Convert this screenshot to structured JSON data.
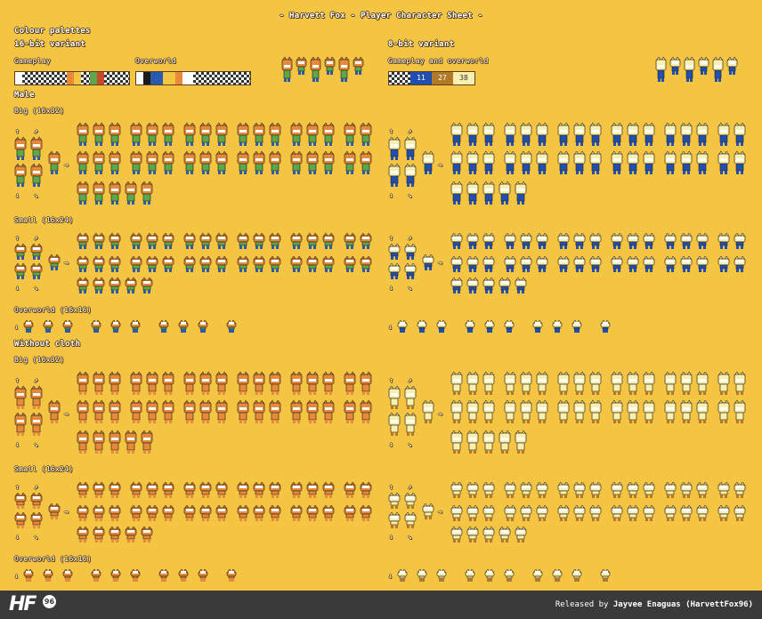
{
  "title": "- Harvett Fox - Player Character Sheet -",
  "palettes_heading": "Colour palettes",
  "variant16": "16-bit variant",
  "variant8": "8-bit variant",
  "gameplay_label": "Gameplay",
  "overworld_label": "Overworld",
  "gameplay_overworld_label": "Gameplay and overworld",
  "palette8_values": [
    "11",
    "27",
    "38"
  ],
  "palette8_colors": [
    "#1f4fb0",
    "#b07a2a",
    "#f7f0b0"
  ],
  "palette16_gameplay_colors": [
    "#ffffff",
    "#1a1a1a",
    "#e88a3a",
    "#f4c542",
    "#5aa84a",
    "#c84a2a",
    "#2a5ab0"
  ],
  "section_male": "Male",
  "section_without_cloth": "Without cloth",
  "big_label": "Big (16x32)",
  "small_label": "Small (16x24)",
  "overworld_size_label": "Overworld (16x16)",
  "colors": {
    "background": "#f4c542",
    "footer": "#3a3a3a",
    "outline": "#5a3f1a"
  },
  "footer": {
    "logo": "HF",
    "logo_badge": "96",
    "released_by": "Released by",
    "author": "Jayvee Enaguas (HarvettFox96)"
  }
}
